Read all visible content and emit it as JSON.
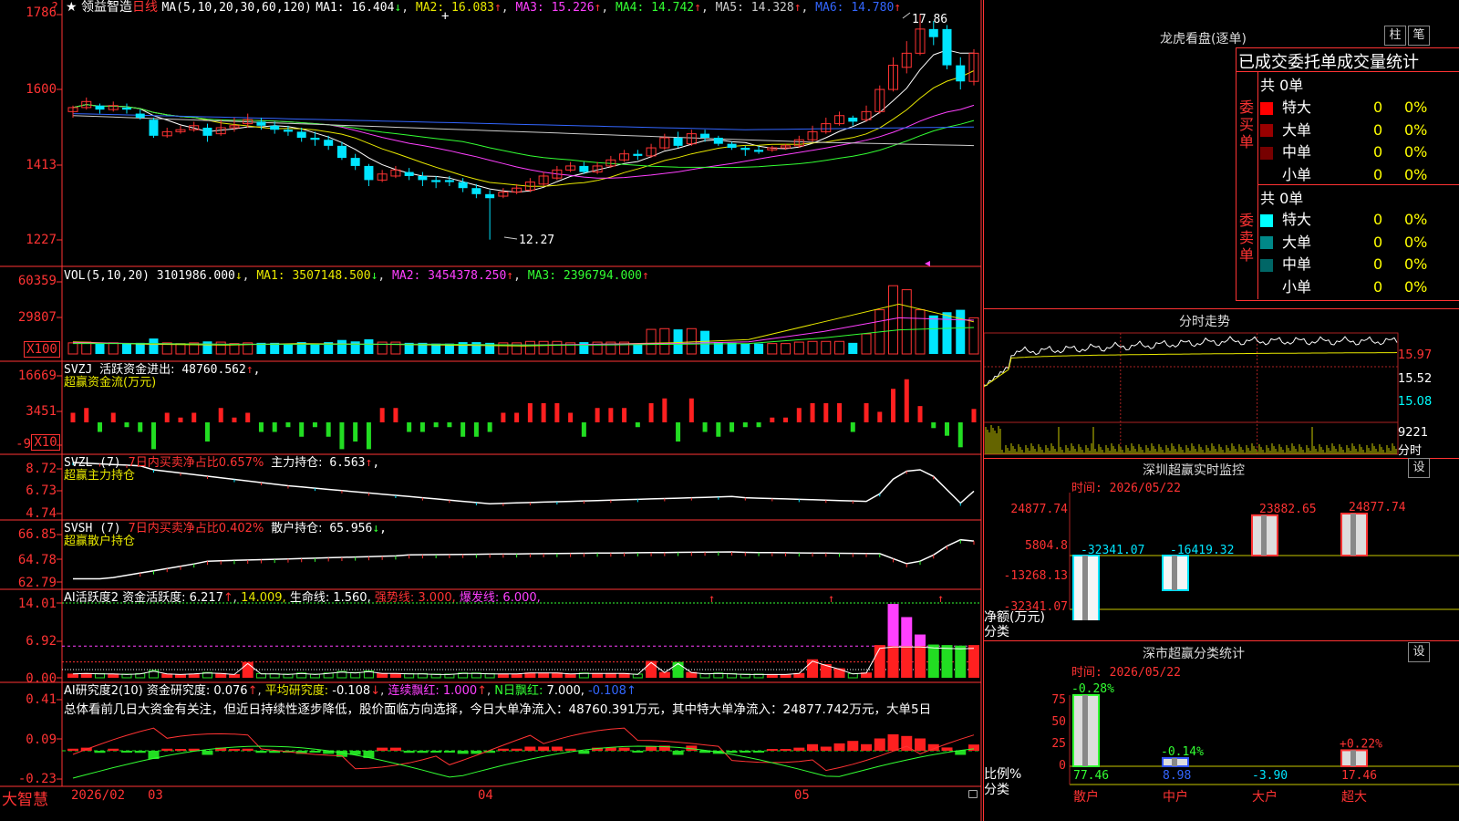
{
  "app": {
    "brand": "大智慧",
    "date_start": "2026/02",
    "month_labels": [
      "03",
      "04",
      "05"
    ]
  },
  "price_panel": {
    "star": "★",
    "stock_name": "领益智造",
    "period": "日线",
    "ma_params": "MA(5,10,20,30,60,120)",
    "ma_items": [
      {
        "label": "MA1:",
        "value": "16.404",
        "arrow": "↓",
        "color": "#ffffff"
      },
      {
        "label": "MA2:",
        "value": "16.083",
        "arrow": "↑",
        "color": "#e8e800"
      },
      {
        "label": "MA3:",
        "value": "15.226",
        "arrow": "↑",
        "color": "#ff40ff"
      },
      {
        "label": "MA4:",
        "value": "14.742",
        "arrow": "↑",
        "color": "#33ff33"
      },
      {
        "label": "MA5:",
        "value": "14.328",
        "arrow": "↑",
        "color": "#cccccc"
      },
      {
        "label": "MA6:",
        "value": "14.780",
        "arrow": "↑",
        "color": "#3366ff"
      }
    ],
    "y_ticks": [
      "1786",
      "1600",
      "1413",
      "1227"
    ],
    "high_label": "17.86",
    "low_label": "12.27",
    "corner_mark": "?"
  },
  "chart_data": {
    "type": "candlestick",
    "note_units": "price in yuan",
    "candles": [
      [
        15.45,
        15.55,
        15.3,
        15.6
      ],
      [
        15.55,
        15.7,
        15.5,
        15.8
      ],
      [
        15.6,
        15.5,
        15.4,
        15.65
      ],
      [
        15.5,
        15.6,
        15.45,
        15.7
      ],
      [
        15.55,
        15.5,
        15.4,
        15.65
      ],
      [
        15.4,
        15.3,
        15.25,
        15.5
      ],
      [
        15.25,
        14.85,
        14.8,
        15.3
      ],
      [
        14.85,
        14.95,
        14.8,
        15.05
      ],
      [
        14.95,
        15.0,
        14.9,
        15.1
      ],
      [
        15.0,
        15.1,
        14.95,
        15.2
      ],
      [
        15.05,
        14.85,
        14.7,
        15.15
      ],
      [
        14.9,
        15.05,
        14.85,
        15.25
      ],
      [
        15.05,
        15.1,
        14.95,
        15.3
      ],
      [
        15.15,
        15.25,
        15.05,
        15.4
      ],
      [
        15.2,
        15.1,
        15.0,
        15.3
      ],
      [
        15.1,
        15.0,
        14.9,
        15.2
      ],
      [
        15.0,
        14.95,
        14.85,
        15.1
      ],
      [
        14.95,
        14.8,
        14.7,
        15.05
      ],
      [
        14.8,
        14.75,
        14.6,
        14.95
      ],
      [
        14.75,
        14.6,
        14.5,
        14.85
      ],
      [
        14.6,
        14.3,
        14.25,
        14.7
      ],
      [
        14.3,
        14.1,
        14.0,
        14.4
      ],
      [
        14.1,
        13.75,
        13.6,
        14.15
      ],
      [
        13.75,
        13.9,
        13.7,
        14.0
      ],
      [
        13.85,
        14.0,
        13.8,
        14.1
      ],
      [
        13.95,
        13.85,
        13.75,
        14.05
      ],
      [
        13.85,
        13.75,
        13.6,
        13.95
      ],
      [
        13.75,
        13.7,
        13.55,
        13.85
      ],
      [
        13.75,
        13.7,
        13.6,
        13.85
      ],
      [
        13.7,
        13.55,
        13.45,
        13.8
      ],
      [
        13.55,
        13.4,
        13.3,
        13.65
      ],
      [
        13.4,
        13.3,
        12.27,
        13.5
      ],
      [
        13.35,
        13.45,
        13.3,
        13.55
      ],
      [
        13.45,
        13.55,
        13.4,
        13.65
      ],
      [
        13.5,
        13.7,
        13.45,
        13.8
      ],
      [
        13.65,
        13.85,
        13.6,
        13.95
      ],
      [
        13.8,
        14.0,
        13.75,
        14.1
      ],
      [
        14.0,
        14.1,
        13.95,
        14.2
      ],
      [
        14.1,
        13.95,
        13.9,
        14.2
      ],
      [
        13.95,
        14.1,
        13.9,
        14.2
      ],
      [
        14.1,
        14.25,
        14.05,
        14.35
      ],
      [
        14.25,
        14.4,
        14.2,
        14.5
      ],
      [
        14.4,
        14.35,
        14.25,
        14.5
      ],
      [
        14.35,
        14.55,
        14.3,
        14.65
      ],
      [
        14.55,
        14.8,
        14.5,
        14.9
      ],
      [
        14.8,
        14.6,
        14.55,
        14.95
      ],
      [
        14.65,
        14.9,
        14.6,
        15.0
      ],
      [
        14.9,
        14.8,
        14.7,
        15.0
      ],
      [
        14.8,
        14.65,
        14.6,
        14.85
      ],
      [
        14.65,
        14.55,
        14.5,
        14.7
      ],
      [
        14.55,
        14.5,
        14.35,
        14.6
      ],
      [
        14.5,
        14.45,
        14.4,
        14.6
      ],
      [
        14.5,
        14.55,
        14.45,
        14.6
      ],
      [
        14.55,
        14.6,
        14.5,
        14.65
      ],
      [
        14.6,
        14.75,
        14.55,
        14.85
      ],
      [
        14.75,
        14.95,
        14.7,
        15.1
      ],
      [
        14.95,
        15.15,
        14.9,
        15.3
      ],
      [
        15.15,
        15.35,
        15.1,
        15.45
      ],
      [
        15.3,
        15.2,
        15.1,
        15.35
      ],
      [
        15.25,
        15.45,
        15.2,
        15.6
      ],
      [
        15.45,
        16.0,
        15.4,
        16.1
      ],
      [
        16.0,
        16.6,
        15.95,
        16.8
      ],
      [
        16.55,
        16.9,
        16.4,
        17.2
      ],
      [
        16.9,
        17.5,
        16.85,
        17.86
      ],
      [
        17.5,
        17.3,
        17.1,
        17.7
      ],
      [
        17.5,
        16.6,
        16.5,
        17.6
      ],
      [
        16.6,
        16.2,
        16.0,
        16.8
      ],
      [
        16.2,
        16.9,
        16.1,
        17.0
      ]
    ],
    "volume": {
      "label": "VOL(5,10,20)",
      "value": "3101986.000",
      "arrow": "↓",
      "ma_items": [
        {
          "label": "MA1:",
          "value": "3507148.500",
          "arrow": "↓",
          "color": "#e8e800"
        },
        {
          "label": "MA2:",
          "value": "3454378.250",
          "arrow": "↑",
          "color": "#ff40ff"
        },
        {
          "label": "MA3:",
          "value": "2396794.000",
          "arrow": "↑",
          "color": "#33ff33"
        }
      ],
      "y_ticks": [
        "60359",
        "29807",
        "X100"
      ]
    }
  },
  "indicators": {
    "svzj": {
      "label": "SVZJ",
      "name": "活跃资金进出:",
      "value": "48760.562",
      "arrow": "↑",
      "tail": ",",
      "subtitle": "超赢资金流(万元)",
      "y_ticks": [
        "16669",
        "3451",
        "-9"
      ],
      "unit": "X10"
    },
    "svzl": {
      "label": "SVZL (7)",
      "red_text": "7日内买卖净占比0.657%",
      "name": "主力持仓:",
      "value": "6.563",
      "arrow": "↑",
      "tail": ",",
      "subtitle": "超赢主力持仓",
      "y_ticks": [
        "8.72",
        "6.73",
        "4.74"
      ]
    },
    "svsh": {
      "label": "SVSH (7)",
      "red_text": "7日内买卖净占比0.402%",
      "name": "散户持仓:",
      "value": "65.956",
      "arrow": "↓",
      "tail": ",",
      "subtitle": "超赢散户持仓",
      "y_ticks": [
        "66.85",
        "64.78",
        "62.79"
      ]
    },
    "ai_active": {
      "label": "AI活跃度2",
      "name": "资金活跃度:",
      "value": "6.217",
      "arrow": "↑",
      "v2": "14.009,",
      "life": "生命线:",
      "life_value": "1.560,",
      "strong": "强势线:",
      "strong_value": "3.000,",
      "burst": "爆发线:",
      "burst_value": "6.000,",
      "y_ticks": [
        "14.01",
        "6.92",
        "0.00"
      ]
    },
    "ai_research": {
      "label": "AI研究度2(10)",
      "name": "资金研究度:",
      "value": "0.076",
      "arrow": "↑",
      "avg": "平均研究度:",
      "avg_value": "-0.108",
      "avg_arrow": "↓",
      "red1": "连续飘红:",
      "red1_value": "1.000",
      "red1_arrow": "↑",
      "red2": "N日飘红:",
      "red2_value": "7.000,",
      "last": "-0.108",
      "last_arrow": "↑",
      "summary": "总体看前几日大资金有关注，但近日持续性逐步降低，股价面临方向选择，今日大单净流入：48760.391万元，其中特大单净流入：24877.742万元，大单5日",
      "y_ticks": [
        "0.41",
        "0.09",
        "-0.23"
      ]
    }
  },
  "dragon_tiger": {
    "title": "龙虎看盘(逐单)",
    "btn1": "柱",
    "btn2": "笔",
    "header": "已成交委托单成交量统计",
    "buy_label": "委买单",
    "sell_label": "委卖单",
    "buy_total": "共 0单",
    "sell_total": "共 0单",
    "buy_rows": [
      {
        "name": "特大",
        "count": "0",
        "pct": "0%",
        "color": "#ff0000"
      },
      {
        "name": "大单",
        "count": "0",
        "pct": "0%",
        "color": "#990000"
      },
      {
        "name": "中单",
        "count": "0",
        "pct": "0%",
        "color": "#770000"
      },
      {
        "name": "小单",
        "count": "0",
        "pct": "0%",
        "color": "#000000"
      }
    ],
    "sell_rows": [
      {
        "name": "特大",
        "count": "0",
        "pct": "0%",
        "color": "#00ffff"
      },
      {
        "name": "大单",
        "count": "0",
        "pct": "0%",
        "color": "#008888"
      },
      {
        "name": "中单",
        "count": "0",
        "pct": "0%",
        "color": "#006666"
      },
      {
        "name": "小单",
        "count": "0",
        "pct": "0%",
        "color": "#000000"
      }
    ]
  },
  "intraday": {
    "title": "分时走势",
    "prices": [
      "15.97",
      "15.52",
      "15.08"
    ],
    "vol": "9221",
    "unit": "分时"
  },
  "sz_monitor": {
    "title": "深圳超赢实时监控",
    "settings": "设",
    "time_label": "时间: 2026/05/22",
    "y_ticks": [
      "24877.74",
      "5804.8",
      "-13268.13",
      "-32341.07"
    ],
    "bars": [
      {
        "cat": "散户",
        "value": -32341.07,
        "label": "-32341.07"
      },
      {
        "cat": "中户",
        "value": -16419.32,
        "label": "-16419.32"
      },
      {
        "cat": "大户",
        "value": 23882.65,
        "label": "23882.65"
      },
      {
        "cat": "超大",
        "value": 24877.74,
        "label": "24877.74"
      }
    ],
    "ylabel1": "净额(万元)",
    "ylabel2": "分类"
  },
  "sz_class": {
    "title": "深市超赢分类统计",
    "settings": "设",
    "time_label": "时间: 2026/05/22",
    "y_ticks": [
      "75",
      "50",
      "25",
      "0"
    ],
    "bars": [
      {
        "cat": "散户",
        "value": 77.46,
        "label": "77.46",
        "delta": "-0.28%"
      },
      {
        "cat": "中户",
        "value": 8.98,
        "label": "8.98",
        "delta": "-0.14%"
      },
      {
        "cat": "大户",
        "value": -3.9,
        "label": "-3.90",
        "delta": ""
      },
      {
        "cat": "超大",
        "value": 17.46,
        "label": "17.46",
        "delta": "+0.22%"
      }
    ],
    "ylabel1": "比例%",
    "ylabel2": "分类"
  }
}
